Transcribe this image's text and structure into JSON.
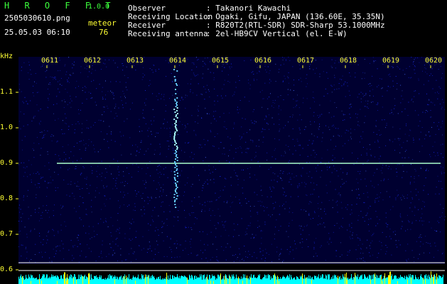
{
  "header": {
    "app_name": "H R O F F T",
    "version": "1.0.0",
    "filename": "2505030610.png",
    "datetime": "25.05.03 06:10",
    "meteor_label": "meteor",
    "meteor_count": "76",
    "info": [
      {
        "label": "Observer",
        "value": ": Takanori Kawachi"
      },
      {
        "label": "Receiving Location",
        "value": ": Ogaki, Gifu, JAPAN (136.60E, 35.35N)"
      },
      {
        "label": "Receiver",
        "value": ": R820T2(RTL-SDR) SDR-Sharp 53.1000MHz"
      },
      {
        "label": "Receiving antenna",
        "value": ": 2el-HB9CV Vertical (el. E-W)"
      }
    ]
  },
  "spectrogram": {
    "y_unit": "kHz",
    "y_ticks": [
      "1.1",
      "1.0",
      "0.9",
      "0.8",
      "0.7",
      "0.6"
    ],
    "x_ticks": [
      "0611",
      "0612",
      "0613",
      "0614",
      "0615",
      "0616",
      "0617",
      "0618",
      "0619",
      "0620"
    ],
    "colors": {
      "background": "#000030",
      "noise": "#1a2cff",
      "carrier": "#aaffcc",
      "meteor": "#66ccff",
      "level_bars": "#00ffff",
      "peaks": "#ffff00"
    }
  }
}
